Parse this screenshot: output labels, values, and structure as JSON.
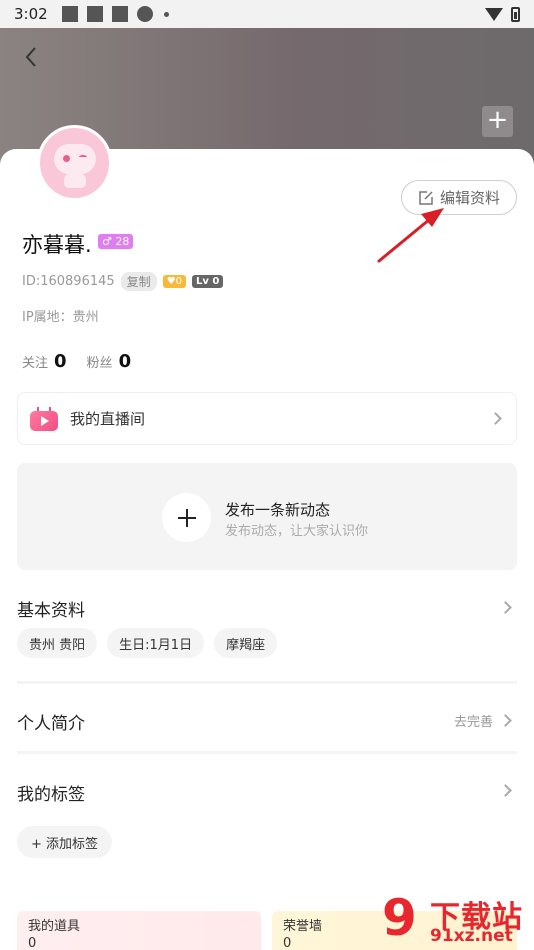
{
  "status_bar": {
    "time": "3:02"
  },
  "profile": {
    "username": "亦暮暮.",
    "gender_age": "♂ 28",
    "id_text": "ID:160896145",
    "copy_label": "复制",
    "heart_badge": "♥0",
    "level_badge": "Lv 0",
    "ip_location": "IP属地：贵州",
    "following_label": "关注",
    "following_count": "0",
    "fans_label": "粉丝",
    "fans_count": "0",
    "edit_label": "编辑资料"
  },
  "live_room": {
    "label": "我的直播间"
  },
  "post": {
    "title": "发布一条新动态",
    "subtitle": "发布动态，让大家认识你"
  },
  "basic_info": {
    "title": "基本资料",
    "tags": [
      "贵州 贵阳",
      "生日:1月1日",
      "摩羯座"
    ]
  },
  "intro": {
    "title": "个人简介",
    "action": "去完善"
  },
  "my_tags": {
    "title": "我的标签",
    "add_label": "+ 添加标签"
  },
  "bottom_cards": [
    {
      "title": "我的道具",
      "value": "0"
    },
    {
      "title": "荣誉墙",
      "value": "0"
    }
  ],
  "watermark": {
    "digits": "9",
    "text": "下载站",
    "url": "91xz.net"
  },
  "colors": {
    "accent_pink": "#f04e83",
    "arrow_red": "#d91f26",
    "badge_purple": "#e07df2"
  }
}
